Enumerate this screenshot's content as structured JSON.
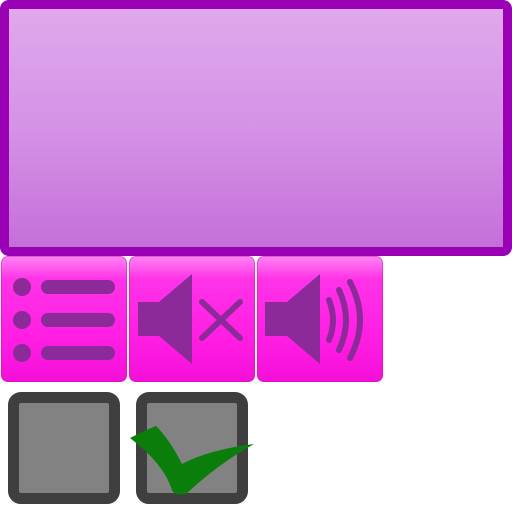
{
  "icons": {
    "list": "list-icon",
    "mute": "speaker-mute-icon",
    "volume": "speaker-volume-icon",
    "check": "checkmark-icon"
  },
  "colors": {
    "panel_border": "#9a00b4",
    "panel_fill": "#d592e6",
    "button_fill": "#ff1ce2",
    "icon_glyph": "#8b2a98",
    "checkbox_border": "#3f3f3f",
    "checkbox_fill": "#828282",
    "checkmark": "#0a7d0a"
  },
  "checkboxes": {
    "first": {
      "checked": false
    },
    "second": {
      "checked": true
    }
  }
}
